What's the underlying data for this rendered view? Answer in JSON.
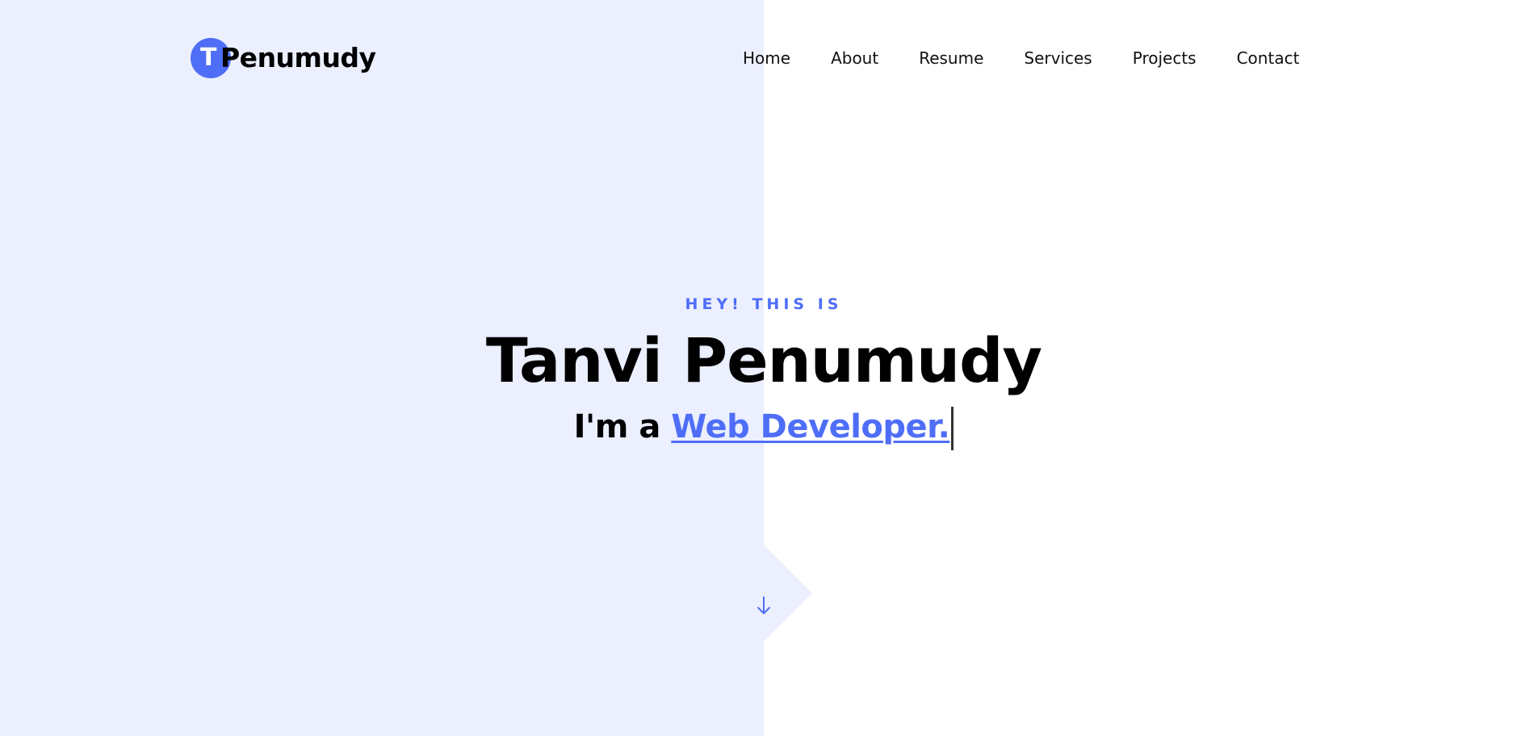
{
  "brand": {
    "logo_letter": "T",
    "logo_text": "Penumudy",
    "accent_color": "#4f6ef7",
    "panel_color": "#ebeffe"
  },
  "nav": {
    "items": [
      {
        "label": "Home"
      },
      {
        "label": "About"
      },
      {
        "label": "Resume"
      },
      {
        "label": "Services"
      },
      {
        "label": "Projects"
      },
      {
        "label": "Contact"
      }
    ]
  },
  "hero": {
    "eyebrow": "HEY! THIS IS",
    "name": "Tanvi Penumudy",
    "sub_prefix": "I'm a",
    "role": "Web Developer."
  },
  "scroll": {
    "icon": "arrow-down-icon"
  }
}
